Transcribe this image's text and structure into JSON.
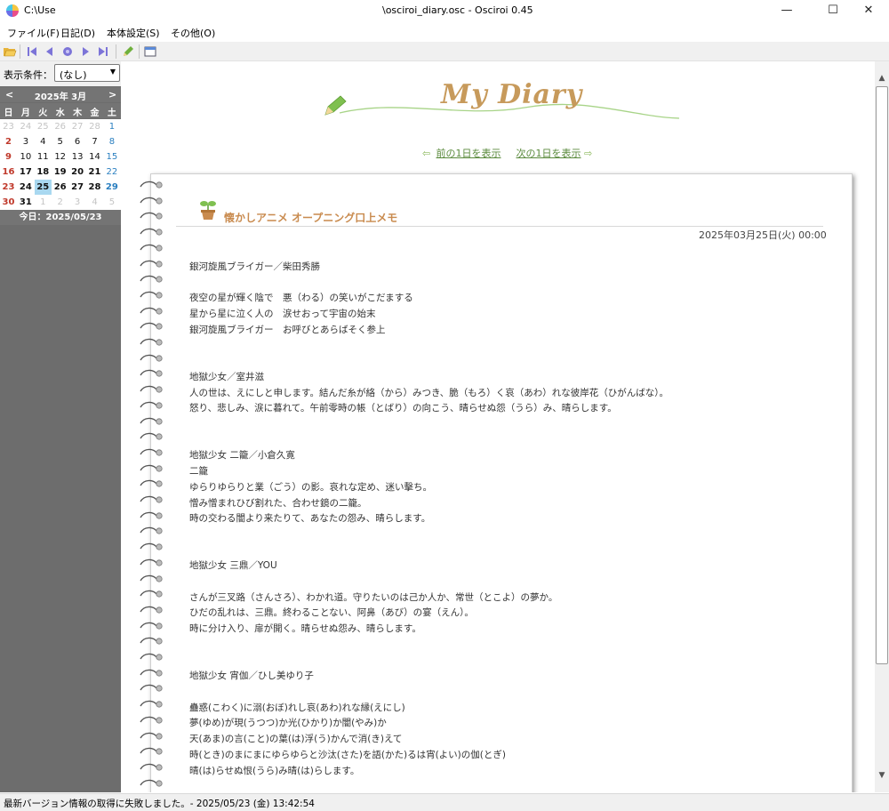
{
  "window": {
    "path": "C:\\Use",
    "title": "\\osciroi_diary.osc - Osciroi 0.45",
    "minimize": "—",
    "maximize": "☐",
    "close": "✕"
  },
  "menu": [
    "ファイル(F)",
    "日記(D)",
    "本体設定(S)",
    "その他(O)"
  ],
  "toolbar": {
    "icons": [
      "folder-open-icon",
      "first-icon",
      "prev-icon",
      "today-icon",
      "next-icon",
      "last-icon",
      "edit-pencil-icon",
      "window-icon"
    ]
  },
  "sidebar": {
    "filter_label": "表示条件：",
    "filter_value": "(なし)",
    "calendar": {
      "prev": "<",
      "next": ">",
      "month": "2025年 3月",
      "weekdays": [
        "日",
        "月",
        "火",
        "水",
        "木",
        "金",
        "土"
      ],
      "weeks": [
        [
          "23",
          "24",
          "25",
          "26",
          "27",
          "28",
          "1"
        ],
        [
          "2",
          "3",
          "4",
          "5",
          "6",
          "7",
          "8"
        ],
        [
          "9",
          "10",
          "11",
          "12",
          "13",
          "14",
          "15"
        ],
        [
          "16",
          "17",
          "18",
          "19",
          "20",
          "21",
          "22"
        ],
        [
          "23",
          "24",
          "25",
          "26",
          "27",
          "28",
          "29"
        ],
        [
          "30",
          "31",
          "1",
          "2",
          "3",
          "4",
          "5"
        ]
      ],
      "selected": "25"
    },
    "today": "今日：2025/05/23"
  },
  "main": {
    "diary_title": "My Diary",
    "prev_link": "前の1日を表示",
    "next_link": "次の1日を表示",
    "entry_title": "懐かしアニメ オープニング口上メモ",
    "entry_date": "2025年03月25日(火) 00:00",
    "body": "銀河旋風ブライガー／柴田秀勝\n\n夜空の星が輝く陰で　悪（わる）の笑いがこだまする\n星から星に泣く人の　涙せおって宇宙の始末\n銀河旋風ブライガー　お呼びとあらばそく参上\n\n\n地獄少女／室井滋\n人の世は、えにしと申します。結んだ糸が絡（から）みつき、脆（もろ）く哀（あわ）れな彼岸花（ひがんばな）。\n怒り、悲しみ、涙に暮れて。午前零時の帳（とばり）の向こう、晴らせぬ怨（うら）み、晴らします。\n\n\n地獄少女 二籠／小倉久寛\n二籠\nゆらりゆらりと業（ごう）の影。哀れな定め、迷い擊ち。\n憎み憎まれひび割れた、合わせ鏡の二籠。\n時の交わる闇より来たりて、あなたの怨み、晴らします。\n\n\n地獄少女 三鼎／YOU\n\nさんが三叉路（さんさろ）、わかれ道。守りたいのは己か人か、常世（とこよ）の夢か。\nひだの乱れは、三鼎。終わることない、阿鼻（あび）の宴（えん）。\n時に分け入り、扉が開く。晴らせぬ怨み、晴らします。\n\n\n地獄少女 宵伽／ひし美ゆり子\n\n蠱惑(こわく)に溺(おぼ)れし哀(あわ)れな縁(えにし)\n夢(ゆめ)が現(うつつ)か光(ひかり)か闇(やみ)か\n天(あま)の言(こと)の葉(は)浮(う)かんで消(き)えて\n時(とき)のまにまにゆらゆらと沙汰(さた)を語(かた)るは宵(よい)の伽(とぎ)\n晴(は)らせぬ恨(うら)み晴(は)らします。"
  },
  "status": "最新バージョン情報の取得に失敗しました。- 2025/05/23 (金) 13:42:54",
  "colors": {
    "sidebar_bg": "#6d6d6d",
    "title_color": "#c79a5b",
    "link_color": "#5a8a3c",
    "sunday": "#c0392b",
    "saturday": "#2a7fc0",
    "selected_day_bg": "#a9d8f0"
  }
}
